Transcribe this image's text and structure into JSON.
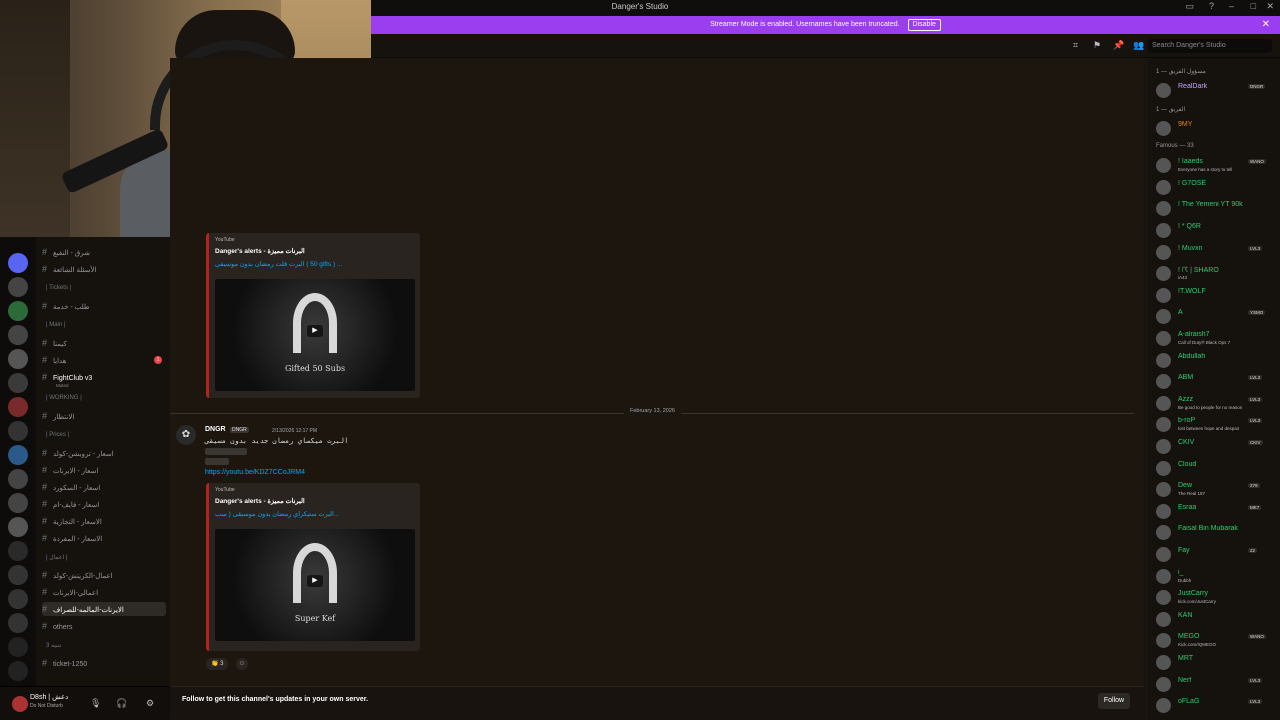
{
  "window": {
    "title": "Danger's Studio"
  },
  "banner": {
    "text": "Streamer Mode is enabled. Usernames have been truncated.",
    "disable_label": "Disable"
  },
  "search": {
    "placeholder": "Search Danger's Studio"
  },
  "channels": [
    {
      "kind": "channel",
      "label": "شرق - النفيع"
    },
    {
      "kind": "channel",
      "label": "الأسئلة الشائعة"
    },
    {
      "kind": "category",
      "label": "| Tickets |"
    },
    {
      "kind": "channel",
      "label": "طلب - خدمة"
    },
    {
      "kind": "category",
      "label": "| Main |"
    },
    {
      "kind": "channel",
      "label": "كيمتا"
    },
    {
      "kind": "channel",
      "label": "هدايا",
      "badge": "1"
    },
    {
      "kind": "channel",
      "label": "FightClub v3",
      "sub": "Muted",
      "highlight": true
    },
    {
      "kind": "category",
      "label": "| WORKING |"
    },
    {
      "kind": "channel",
      "label": "الانتظار"
    },
    {
      "kind": "category",
      "label": "| Prices |"
    },
    {
      "kind": "channel",
      "label": "اسعار - ترويشن-كولد"
    },
    {
      "kind": "channel",
      "label": "اسعار - الايرنات"
    },
    {
      "kind": "channel",
      "label": "اسعار - السكورد"
    },
    {
      "kind": "channel",
      "label": "اسعار - فايف-ام"
    },
    {
      "kind": "channel",
      "label": "الاسعار - التجارية"
    },
    {
      "kind": "channel",
      "label": "الاسعار - المفردة"
    },
    {
      "kind": "category",
      "label": "| اعمال |"
    },
    {
      "kind": "channel",
      "label": "اعمال-الكريتش-كولد"
    },
    {
      "kind": "channel",
      "label": "اعمالي-الايرنات"
    },
    {
      "kind": "channel",
      "label": "الايرنات-المالمه-للصراف",
      "active": true
    },
    {
      "kind": "channel",
      "label": "others"
    },
    {
      "kind": "category",
      "label": "3 تنبيه"
    },
    {
      "kind": "channel",
      "label": "ticket-1250"
    }
  ],
  "user": {
    "name": "D8sh | دعش",
    "status": "Do Not Disturb"
  },
  "embed1": {
    "provider": "YouTube",
    "author": "Danger's alerts - البرنات مميزة",
    "title": "البرت قلت رمضان بدون موسيقى ( 50 gifts ) ...",
    "caption": "Gifted 50 Subs"
  },
  "divider": {
    "date": "February 13, 2026"
  },
  "message": {
    "author": "DNGR",
    "tag": "DNGR",
    "timestamp": "2/13/2026 12:17 PM",
    "text": "البرت ميكساي رمضان جديد بدون مسيقى",
    "link": "https://youtu.be/KDZ7CCoJRM4"
  },
  "embed2": {
    "provider": "YouTube",
    "author": "Danger's alerts - البرنات مميزة",
    "title": "البرت ستيكراي رمضان بدون موسيقى ( سب...",
    "caption": "Super Kef"
  },
  "reactions": {
    "count": "3"
  },
  "follow": {
    "text": "Follow to get this channel's updates in your own server.",
    "button": "Follow"
  },
  "members": [
    {
      "kind": "header",
      "label": "مسؤول الفريق — 1"
    },
    {
      "kind": "member",
      "name": "RealDark",
      "sub": "",
      "color": "#c7a4ff",
      "tag": "DNGR"
    },
    {
      "kind": "header",
      "label": "الفريق — 1"
    },
    {
      "kind": "member",
      "name": "9MY",
      "sub": "",
      "color": "#e67e22"
    },
    {
      "kind": "header",
      "label": "Famous — 33"
    },
    {
      "kind": "member",
      "name": "! Iaaeds",
      "sub": "Everyone has a story to tell",
      "color": "#2ecc71",
      "tag": "WANO"
    },
    {
      "kind": "member",
      "name": "! G7OSE",
      "sub": "",
      "color": "#2ecc71"
    },
    {
      "kind": "member",
      "name": "! The Yemeni YT 90k",
      "sub": "",
      "color": "#2ecc71"
    },
    {
      "kind": "member",
      "name": "! * Q6R",
      "sub": "",
      "color": "#2ecc71"
    },
    {
      "kind": "member",
      "name": "! Muvxn",
      "sub": "",
      "color": "#2ecc71",
      "tag": "LVL3"
    },
    {
      "kind": "member",
      "name": "! ☈ | SHARO",
      "sub": "iA43",
      "color": "#2ecc71"
    },
    {
      "kind": "member",
      "name": "!T.WOLF",
      "sub": "",
      "color": "#2ecc71"
    },
    {
      "kind": "member",
      "name": "A",
      "sub": "",
      "color": "#2ecc71",
      "tag": "YSMO"
    },
    {
      "kind": "member",
      "name": "A-alraish7",
      "sub": "Call of Duty® Black Ops 7",
      "color": "#2ecc71"
    },
    {
      "kind": "member",
      "name": "Abdullah",
      "sub": "",
      "color": "#2ecc71"
    },
    {
      "kind": "member",
      "name": "ABM",
      "sub": "",
      "color": "#2ecc71",
      "tag": "LVL3"
    },
    {
      "kind": "member",
      "name": "Azzz",
      "sub": "Be good to people for no reason",
      "color": "#2ecc71",
      "tag": "LVL3"
    },
    {
      "kind": "member",
      "name": "b-roP",
      "sub": "lost between hope and despair",
      "color": "#2ecc71",
      "tag": "LVL3"
    },
    {
      "kind": "member",
      "name": "CKIV",
      "sub": "",
      "color": "#2ecc71",
      "tag": "CKIV"
    },
    {
      "kind": "member",
      "name": "Cloud",
      "sub": "",
      "color": "#2ecc71"
    },
    {
      "kind": "member",
      "name": "Dew",
      "sub": "The Real 187",
      "color": "#2ecc71",
      "tag": "279"
    },
    {
      "kind": "member",
      "name": "Esraa",
      "sub": "",
      "color": "#2ecc71",
      "tag": "MK7"
    },
    {
      "kind": "member",
      "name": "Faisal Bin Mubarak",
      "sub": "",
      "color": "#2ecc71"
    },
    {
      "kind": "member",
      "name": "Fay",
      "sub": "",
      "color": "#2ecc71",
      "tag": "22"
    },
    {
      "kind": "member",
      "name": "i_",
      "sub": "Dubbh",
      "color": "#2ecc71"
    },
    {
      "kind": "member",
      "name": "JustCarry",
      "sub": "kick.com/JustCarry",
      "color": "#2ecc71"
    },
    {
      "kind": "member",
      "name": "KAN",
      "sub": "",
      "color": "#2ecc71"
    },
    {
      "kind": "member",
      "name": "MEGO",
      "sub": "Kick.com/IQMEGO",
      "color": "#2ecc71",
      "tag": "WANO"
    },
    {
      "kind": "member",
      "name": "MRT",
      "sub": "",
      "color": "#2ecc71"
    },
    {
      "kind": "member",
      "name": "Nerf",
      "sub": "",
      "color": "#2ecc71",
      "tag": "LVL3"
    },
    {
      "kind": "member",
      "name": "oFLaG",
      "sub": "",
      "color": "#2ecc71",
      "tag": "LVL3"
    }
  ]
}
